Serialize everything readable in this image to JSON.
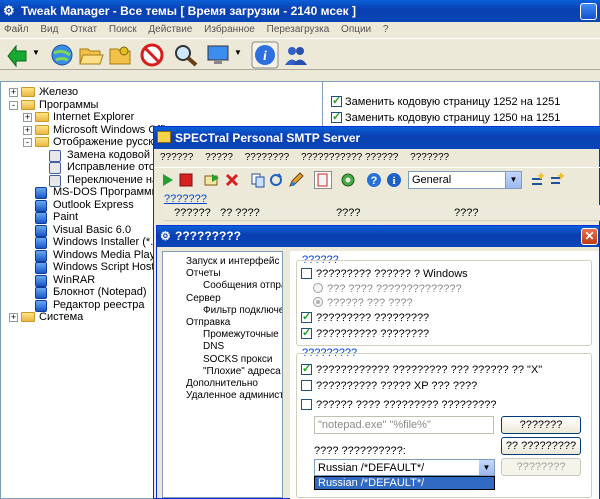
{
  "tweak": {
    "title": "Tweak Manager - Все темы  [ Время загрузки - 2140 мсек ]",
    "menu": [
      "Файл",
      "Вид",
      "Откат",
      "Поиск",
      "Действие",
      "Избранное",
      "Перезагрузка",
      "Опции",
      "?"
    ],
    "toolbar_icons": [
      "back-arrow-icon",
      "globe-icon",
      "open-folder-icon",
      "key-folder-icon",
      "no-entry-icon",
      "search-icon",
      "monitor-icon",
      "info-icon",
      "users-icon"
    ],
    "tree": [
      {
        "label": "Железо",
        "type": "folder",
        "expander": "+"
      },
      {
        "label": "Программы",
        "type": "folder",
        "expander": "-"
      },
      {
        "label": "Internet Explorer",
        "type": "folder",
        "expander": "+"
      },
      {
        "label": "Microsoft Windows Office",
        "type": "folder",
        "expander": "+"
      },
      {
        "label": "Отображение русских шри",
        "type": "folder",
        "expander": "-"
      },
      {
        "label": "Замена кодовой стран",
        "type": "page"
      },
      {
        "label": "Исправление отображ",
        "type": "page"
      },
      {
        "label": "Переключение на рус",
        "type": "page"
      },
      {
        "label": "MS-DOS Программы",
        "type": "program"
      },
      {
        "label": "Outlook Express",
        "type": "program"
      },
      {
        "label": "Paint",
        "type": "program"
      },
      {
        "label": "Visual Basic 6.0",
        "type": "program"
      },
      {
        "label": "Windows Installer (*.msi)",
        "type": "program"
      },
      {
        "label": "Windows Media Player",
        "type": "program"
      },
      {
        "label": "Windows Script Host (WSH",
        "type": "program"
      },
      {
        "label": "WinRAR",
        "type": "program"
      },
      {
        "label": "Блокнот (Notepad)",
        "type": "program"
      },
      {
        "label": "Редактор реестра",
        "type": "program"
      },
      {
        "label": "Система",
        "type": "folder",
        "expander": "+"
      }
    ],
    "options": [
      {
        "label": "Заменить кодовую страницу 1252 на 1251",
        "checked": true
      },
      {
        "label": "Заменить кодовую страницу 1250 на 1251",
        "checked": true
      }
    ]
  },
  "smtp": {
    "title": "SPECTral Personal SMTP Server",
    "menu": [
      "??????",
      "?????",
      "????????",
      "??????????? ??????",
      "???????"
    ],
    "combo_value": "General",
    "section_link": "???????",
    "columns": [
      "??????",
      "?? ????",
      "????",
      "????"
    ]
  },
  "dialog": {
    "title": "?????????",
    "nav": [
      {
        "label": "Запуск и интерфейс",
        "level": 0
      },
      {
        "label": "Отчеты",
        "level": 0
      },
      {
        "label": "Сообщения отправ",
        "level": 1
      },
      {
        "label": "Сервер",
        "level": 0
      },
      {
        "label": "Фильтр подключе",
        "level": 1
      },
      {
        "label": "Отправка",
        "level": 0
      },
      {
        "label": "Промежуточные SM",
        "level": 1
      },
      {
        "label": "DNS",
        "level": 1
      },
      {
        "label": "SOCKS прокси",
        "level": 1
      },
      {
        "label": "\"Плохие\" адреса",
        "level": 1
      },
      {
        "label": "Дополнительно",
        "level": 0
      },
      {
        "label": "Удаленное администри",
        "level": 0
      }
    ],
    "group1": {
      "title": "??????",
      "windows_check": "????????? ?????? ? Windows",
      "radio1": "??? ???? ??????????????",
      "radio2": "?????? ??? ????",
      "check2": "????????? ?????????",
      "check3": "?????????? ????????"
    },
    "group2": {
      "title": "?????????",
      "check1": "???????????? ????????? ??? ?????? ?? \"X\"",
      "check2": "?????????? ????? XP ??? ????",
      "check3": "?????? ???? ????????? ?????????",
      "path_value": "\"notepad.exe\" \"%file%\"",
      "button1": "???????",
      "button2": "?? ?????????",
      "lang_label": "???? ??????????:",
      "lang_value": "Russian /*DEFAULT*/",
      "lang_button": "????????",
      "dropdown_option": "Russian /*DEFAULT*/"
    }
  }
}
